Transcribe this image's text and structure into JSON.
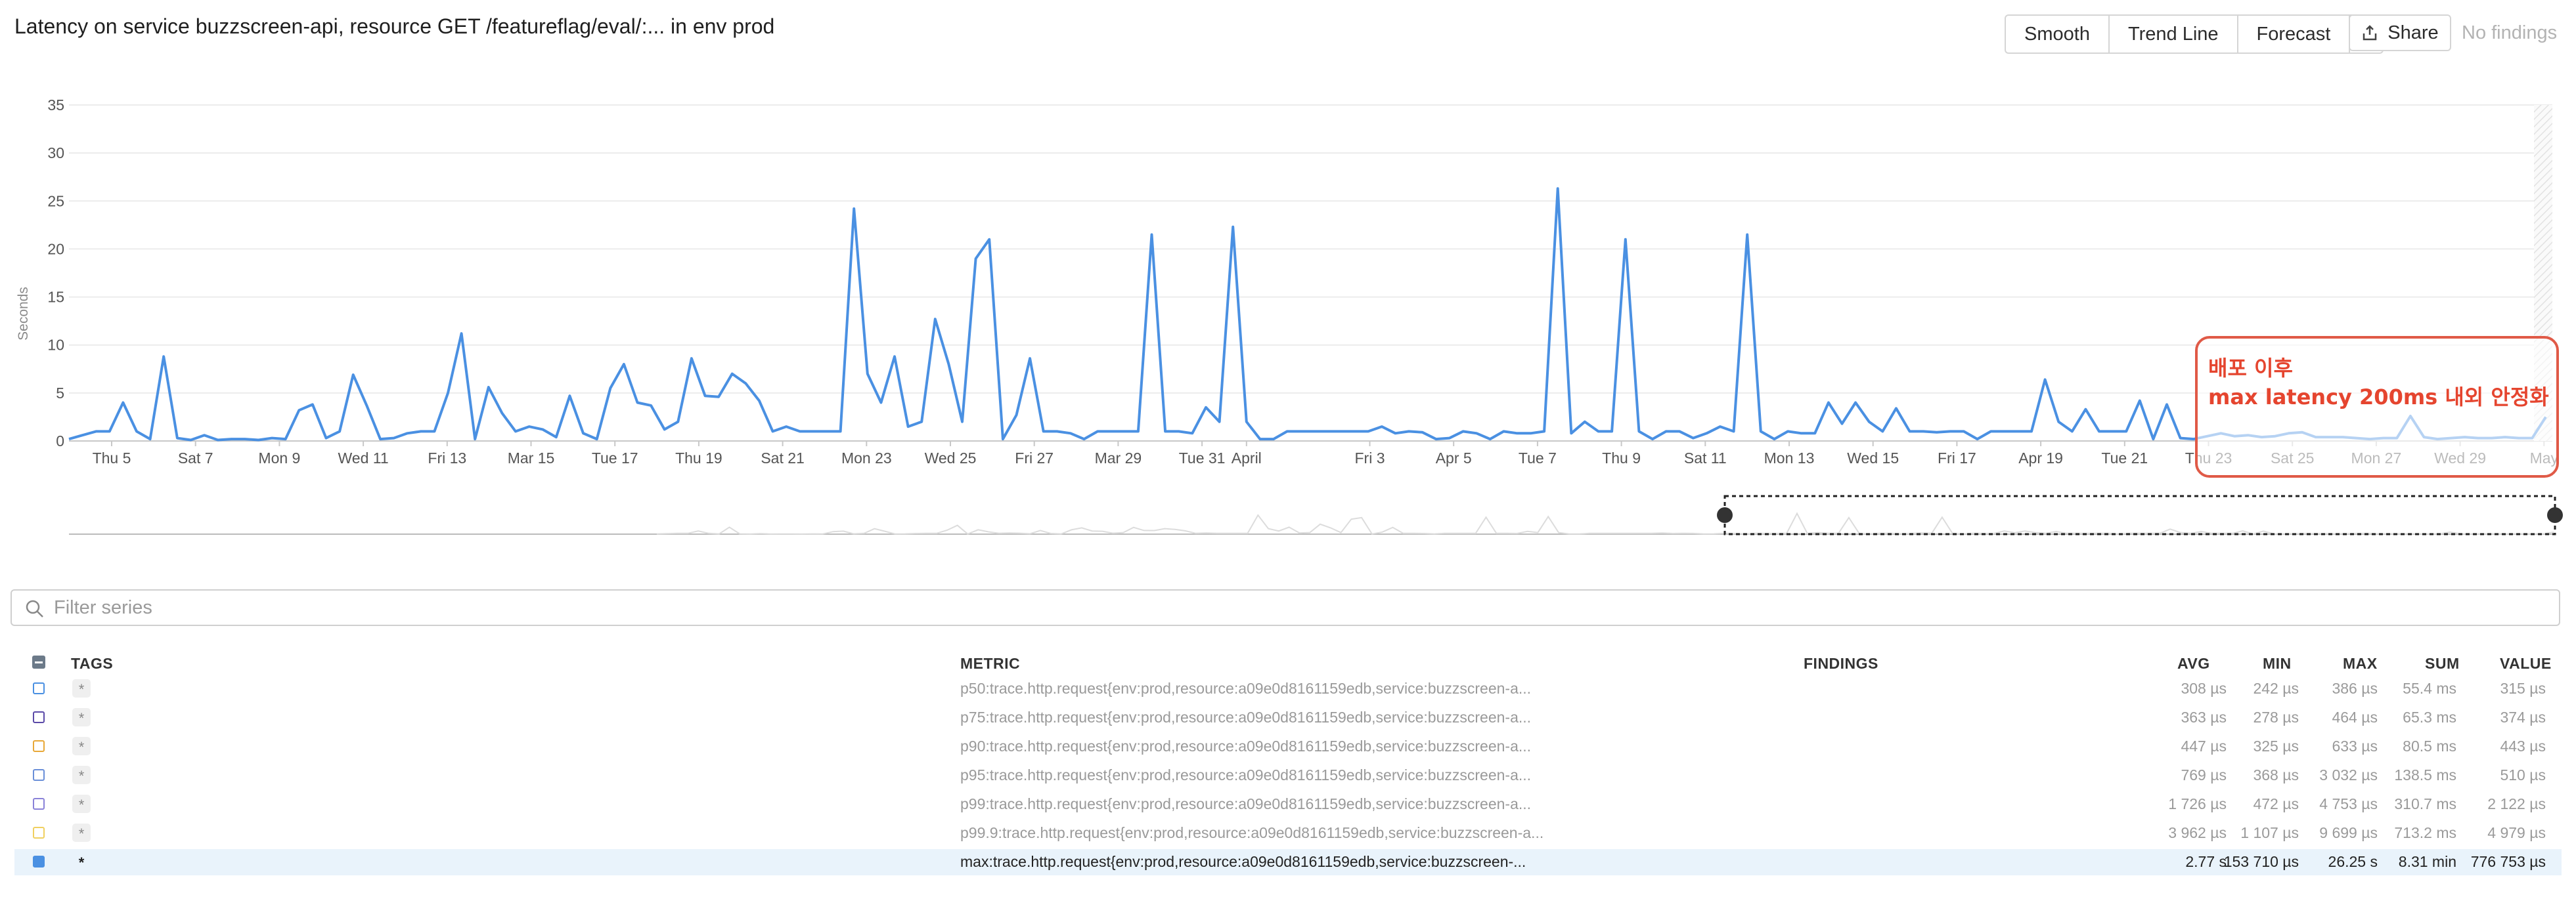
{
  "title": "Latency on service buzzscreen-api, resource GET /featureflag/eval/:... in env prod",
  "toolbar": {
    "smooth": "Smooth",
    "trend": "Trend Line",
    "forecast": "Forecast",
    "add": "+",
    "share": "Share",
    "no_findings": "No findings"
  },
  "colors": {
    "line": "#4a90e2",
    "annotation": "#e5452f",
    "selected_row": "#e9f3fb"
  },
  "annotation": {
    "line1": "배포 이후",
    "line2": "max latency 200ms 내외 안정화"
  },
  "filter": {
    "placeholder": "Filter series"
  },
  "table": {
    "headers": {
      "tags": "TAGS",
      "metric": "METRIC",
      "findings": "FINDINGS",
      "avg": "AVG",
      "min": "MIN",
      "max": "MAX",
      "sum": "SUM",
      "value": "VALUE"
    },
    "rows": [
      {
        "color": "#4a90e2",
        "tag": "*",
        "metric": "p50:trace.http.request{env:prod,resource:a09e0d8161159edb,service:buzzscreen-a...",
        "avg": "308 µs",
        "min": "242 µs",
        "max": "386 µs",
        "sum": "55.4 ms",
        "value": "315 µs"
      },
      {
        "color": "#5b4aa8",
        "tag": "*",
        "metric": "p75:trace.http.request{env:prod,resource:a09e0d8161159edb,service:buzzscreen-a...",
        "avg": "363 µs",
        "min": "278 µs",
        "max": "464 µs",
        "sum": "65.3 ms",
        "value": "374 µs"
      },
      {
        "color": "#e8a838",
        "tag": "*",
        "metric": "p90:trace.http.request{env:prod,resource:a09e0d8161159edb,service:buzzscreen-a...",
        "avg": "447 µs",
        "min": "325 µs",
        "max": "633 µs",
        "sum": "80.5 ms",
        "value": "443 µs"
      },
      {
        "color": "#6a8fd8",
        "tag": "*",
        "metric": "p95:trace.http.request{env:prod,resource:a09e0d8161159edb,service:buzzscreen-a...",
        "avg": "769 µs",
        "min": "368 µs",
        "max": "3 032 µs",
        "sum": "138.5 ms",
        "value": "510 µs"
      },
      {
        "color": "#8a82d8",
        "tag": "*",
        "metric": "p99:trace.http.request{env:prod,resource:a09e0d8161159edb,service:buzzscreen-a...",
        "avg": "1 726 µs",
        "min": "472 µs",
        "max": "4 753 µs",
        "sum": "310.7 ms",
        "value": "2 122 µs"
      },
      {
        "color": "#f0d060",
        "tag": "*",
        "metric": "p99.9:trace.http.request{env:prod,resource:a09e0d8161159edb,service:buzzscreen-a...",
        "avg": "3 962 µs",
        "min": "1 107 µs",
        "max": "9 699 µs",
        "sum": "713.2 ms",
        "value": "4 979 µs"
      },
      {
        "color": "#4a90e2",
        "tag": "*",
        "metric": "max:trace.http.request{env:prod,resource:a09e0d8161159edb,service:buzzscreen-...",
        "avg": "2.77 s",
        "min": "153 710 µs",
        "max": "26.25 s",
        "sum": "8.31 min",
        "value": "776 753 µs"
      }
    ]
  },
  "chart_data": {
    "type": "line",
    "ylabel": "Seconds",
    "ylim": [
      0,
      35
    ],
    "yticks": [
      0,
      5,
      10,
      15,
      20,
      25,
      30,
      35
    ],
    "xlabels": [
      "Thu 5",
      "Sat 7",
      "Mon 9",
      "Wed 11",
      "Fri 13",
      "Mar 15",
      "Tue 17",
      "Thu 19",
      "Sat 21",
      "Mon 23",
      "Wed 25",
      "Fri 27",
      "Mar 29",
      "Tue 31",
      "April",
      "Fri 3",
      "Apr 5",
      "Tue 7",
      "Thu 9",
      "Sat 11",
      "Mon 13",
      "Wed 15",
      "Fri 17",
      "Apr 19",
      "Tue 21",
      "Thu 23",
      "Sat 25",
      "Mon 27",
      "Wed 29",
      "May"
    ],
    "grid": true,
    "series": [
      {
        "values": [
          0.2,
          0.6,
          1.0,
          1.0,
          4.0,
          1.0,
          0.2,
          8.8,
          0.3,
          0.1,
          0.6,
          0.1,
          0.2,
          0.2,
          0.1,
          0.3,
          0.2,
          3.2,
          3.8,
          0.3,
          1.0,
          6.9,
          3.7,
          0.2,
          0.3,
          0.8,
          1.0,
          1.0,
          5.0,
          11.2,
          0.2,
          5.6,
          2.9,
          1.0,
          1.5,
          1.2,
          0.4,
          4.7,
          0.8,
          0.2,
          5.5,
          8.0,
          4.0,
          3.7,
          1.2,
          2.0,
          8.6,
          4.7,
          4.6,
          7.0,
          6.0,
          4.2,
          1.0,
          1.5,
          1.0,
          1.0,
          1.0,
          1.0,
          24.2,
          7.0,
          4.0,
          8.8,
          1.5,
          2.0,
          12.7,
          8.0,
          2.0,
          19.0,
          21.0,
          0.2,
          2.7,
          8.6,
          1.0,
          1.0,
          0.8,
          0.2,
          1.0,
          1.0,
          1.0,
          1.0,
          21.5,
          1.0,
          1.0,
          0.8,
          3.5,
          2.0,
          22.3,
          2.0,
          0.2,
          0.2,
          1.0,
          1.0,
          1.0,
          1.0,
          1.0,
          1.0,
          1.0,
          1.5,
          0.8,
          1.0,
          0.9,
          0.2,
          0.3,
          1.0,
          0.8,
          0.2,
          1.0,
          0.8,
          0.8,
          1.0,
          26.3,
          0.8,
          2.0,
          1.0,
          1.0,
          21.0,
          1.0,
          0.2,
          1.0,
          1.0,
          0.3,
          0.8,
          1.5,
          1.0,
          21.5,
          1.0,
          0.2,
          1.0,
          0.8,
          0.8,
          4.0,
          1.8,
          4.0,
          2.0,
          1.0,
          3.4,
          1.0,
          1.0,
          0.9,
          1.0,
          1.0,
          0.2,
          1.0,
          1.0,
          1.0,
          1.0,
          6.4,
          2.0,
          1.0,
          3.3,
          1.0,
          1.0,
          1.0,
          4.2,
          0.2,
          3.8,
          0.3,
          0.2,
          0.5,
          0.8,
          0.5,
          0.6,
          0.4,
          0.5,
          0.8,
          0.9,
          0.4,
          0.4,
          0.4,
          0.3,
          0.2,
          0.3,
          0.3,
          2.6,
          0.4,
          0.2,
          0.3,
          0.4,
          0.3,
          0.3,
          0.4,
          0.3,
          0.3,
          2.5
        ]
      }
    ]
  }
}
